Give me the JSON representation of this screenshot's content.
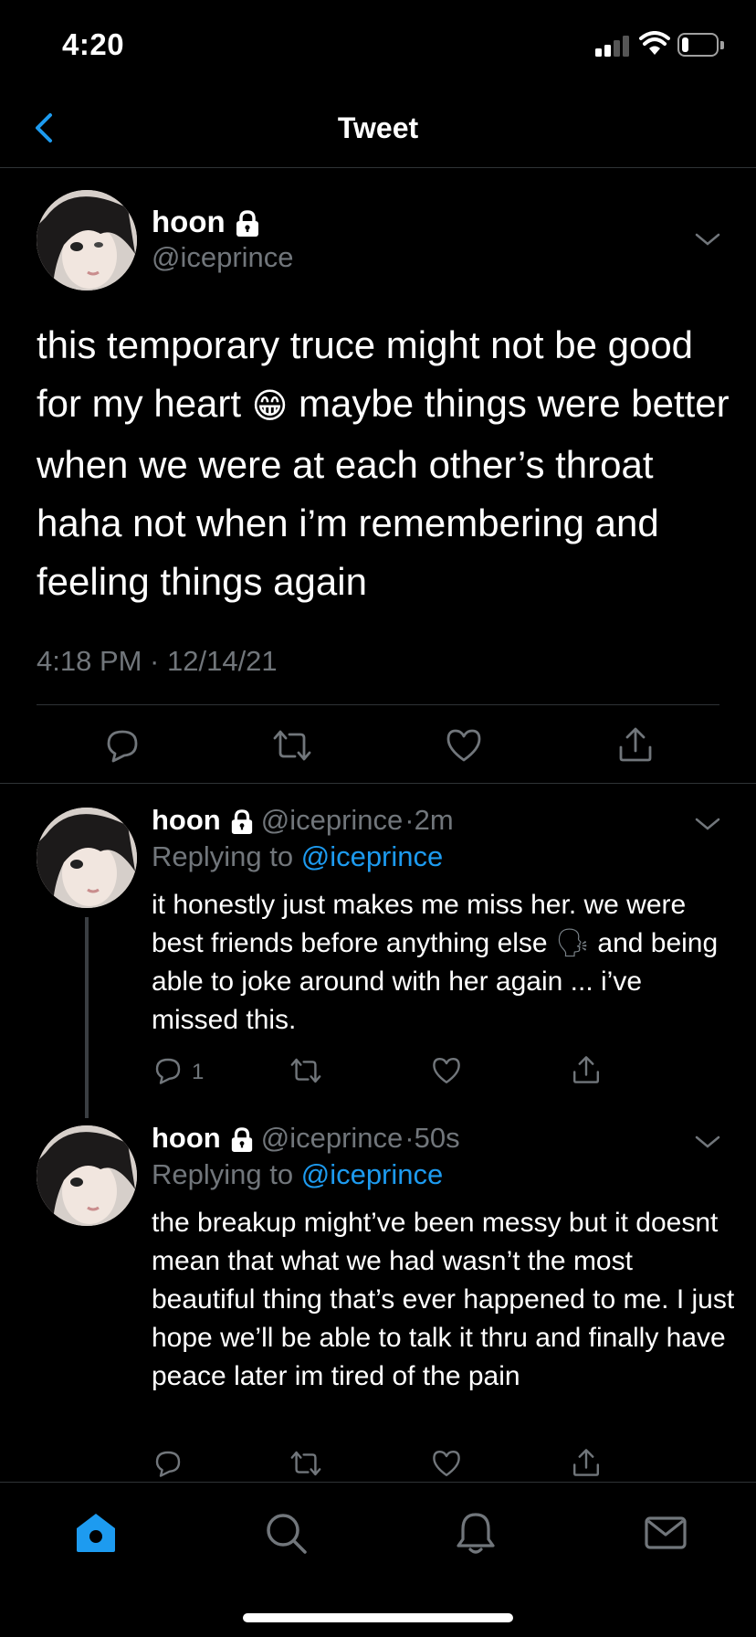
{
  "status_bar": {
    "time": "4:20",
    "battery_level": 0.2
  },
  "nav": {
    "title": "Tweet",
    "back_icon": "chevron-left-icon"
  },
  "colors": {
    "accent": "#1d9bf0",
    "muted": "#71767b",
    "background": "#000000",
    "divider": "#2f3336"
  },
  "main_tweet": {
    "name": "hoon",
    "handle": "@iceprince",
    "text_before_emoji": "this temporary truce might not be good for my heart ",
    "emoji": "😁",
    "text_after_emoji": " maybe things were better when we were at each other’s throat haha not when i’m remembering and feeling things again",
    "timestamp": "4:18 PM · 12/14/21",
    "actions": [
      "reply-icon",
      "retweet-icon",
      "like-icon",
      "share-icon"
    ]
  },
  "replies": [
    {
      "name": "hoon",
      "handle": "@iceprince",
      "time": "2m",
      "replying_prefix": "Replying to ",
      "replying_to": "@iceprince",
      "text_main": "it honestly just makes me miss her. we were best friends before anything else ",
      "emoji": "🗣",
      "text_rest": " and being able to joke around with her again ... i’ve missed this.",
      "reply_count": "1"
    },
    {
      "name": "hoon",
      "handle": "@iceprince",
      "time": "50s",
      "replying_prefix": "Replying to ",
      "replying_to": "@iceprince",
      "text": "the breakup might’ve been messy but it doesnt mean that what we had wasn’t the most beautiful thing that’s ever happened to me. I just hope we’ll be able to talk it thru and finally have peace later im tired of the pain",
      "reply_count": ""
    }
  ],
  "tab_bar": {
    "tabs": [
      "home-icon",
      "search-icon",
      "notifications-icon",
      "messages-icon"
    ],
    "active": "home-icon"
  }
}
